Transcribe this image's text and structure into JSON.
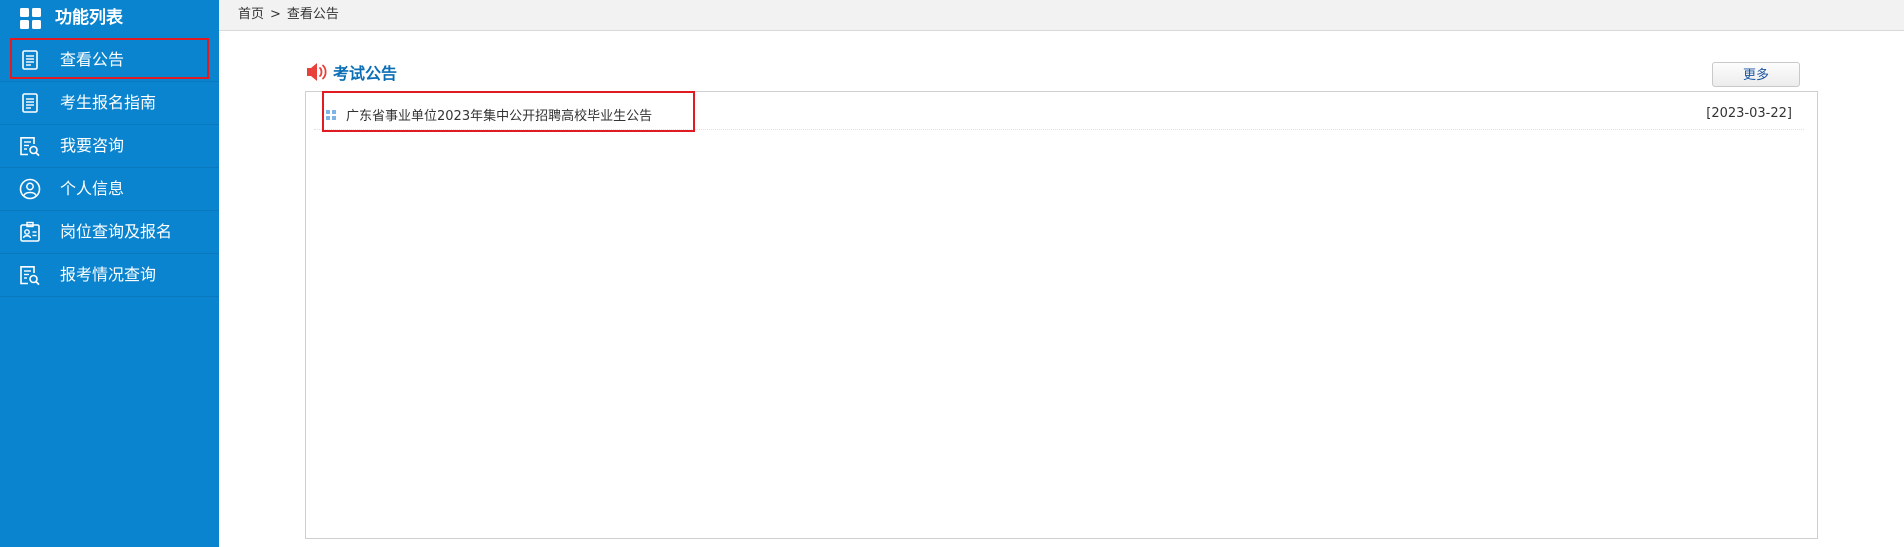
{
  "sidebar": {
    "header_label": "功能列表",
    "header_icon": "grid-icon",
    "items": [
      {
        "label": "查看公告",
        "icon": "document-list-icon",
        "active": true
      },
      {
        "label": "考生报名指南",
        "icon": "document-list-icon",
        "active": false
      },
      {
        "label": "我要咨询",
        "icon": "document-search-icon",
        "active": false
      },
      {
        "label": "个人信息",
        "icon": "user-circle-icon",
        "active": false
      },
      {
        "label": "岗位查询及报名",
        "icon": "id-badge-icon",
        "active": false
      },
      {
        "label": "报考情况查询",
        "icon": "document-search-icon",
        "active": false
      }
    ]
  },
  "breadcrumb": {
    "home": "首页",
    "separator": ">",
    "current": "查看公告"
  },
  "panel": {
    "title": "考试公告",
    "title_icon": "speaker-icon",
    "more_label": "更多",
    "notices": [
      {
        "title": "广东省事业单位2023年集中公开招聘高校毕业生公告",
        "date": "[2023-03-22]",
        "highlighted": true
      }
    ]
  },
  "colors": {
    "sidebar_bg": "#0b84cf",
    "accent_blue": "#0b6fb6",
    "highlight_red": "#e11b22",
    "speaker_red": "#e8413b"
  }
}
